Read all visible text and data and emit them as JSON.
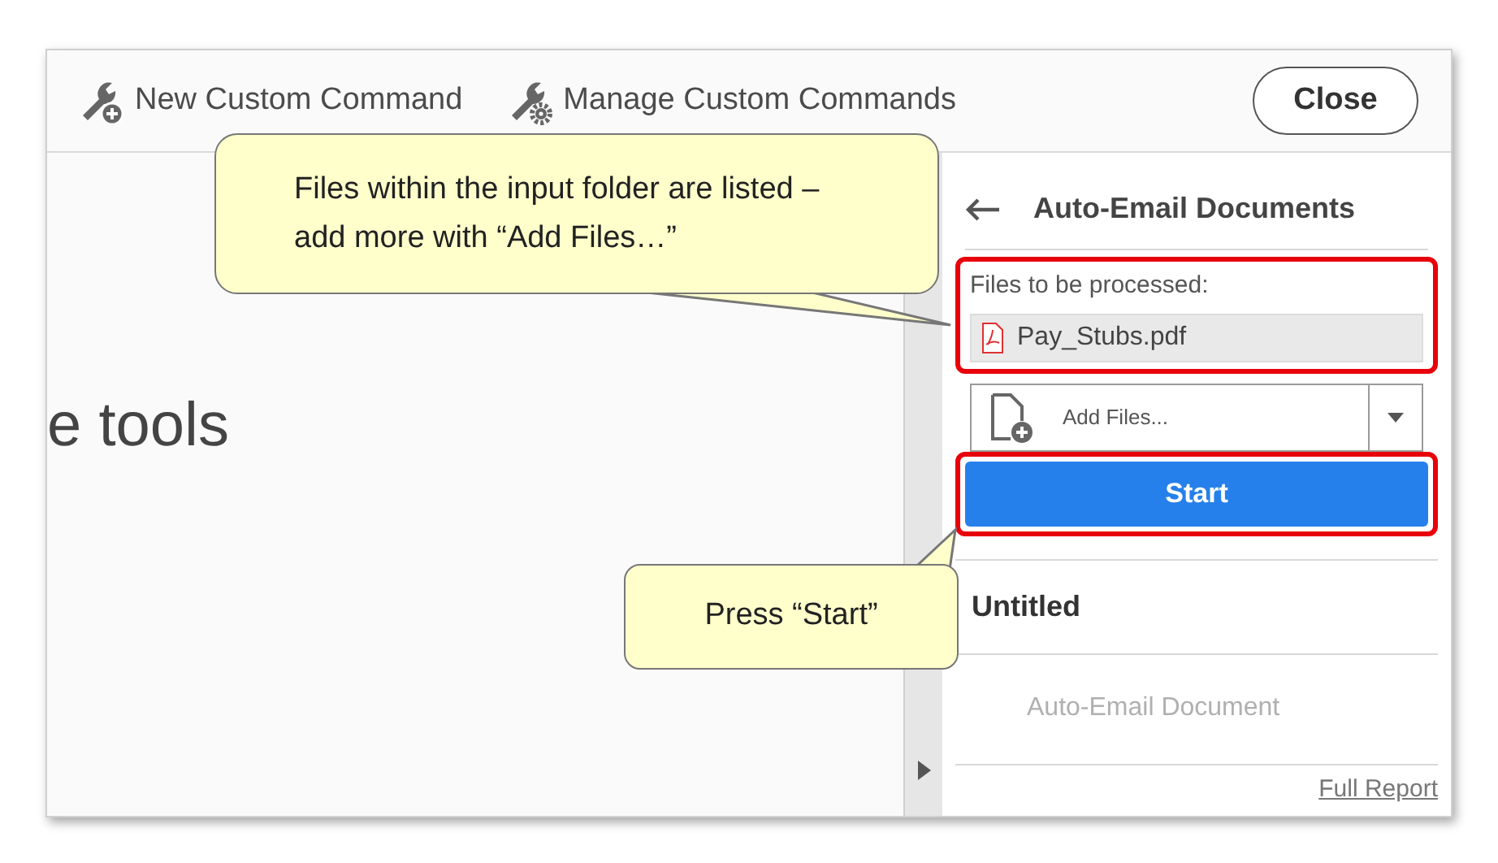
{
  "toolbar": {
    "items": [
      {
        "kind": "new",
        "label": "New Custom Command"
      },
      {
        "kind": "manage",
        "label": "Manage Custom Commands"
      }
    ],
    "close_button": "Close"
  },
  "main": {
    "heading_fragment": "e tools"
  },
  "callouts": [
    {
      "text": "Files within the input folder are listed – add more with “Add Files…”"
    },
    {
      "text": "Press “Start”"
    }
  ],
  "panel": {
    "title": "Auto-Email Documents",
    "files_label": "Files to be processed:",
    "files": [
      {
        "name": "Pay_Stubs.pdf"
      }
    ],
    "add_files_button": "Add Files...",
    "start_button": "Start",
    "section_title": "Untitled",
    "actions": [
      {
        "label": "Auto-Email Document",
        "disabled": true
      }
    ],
    "full_report_link": "Full Report"
  }
}
